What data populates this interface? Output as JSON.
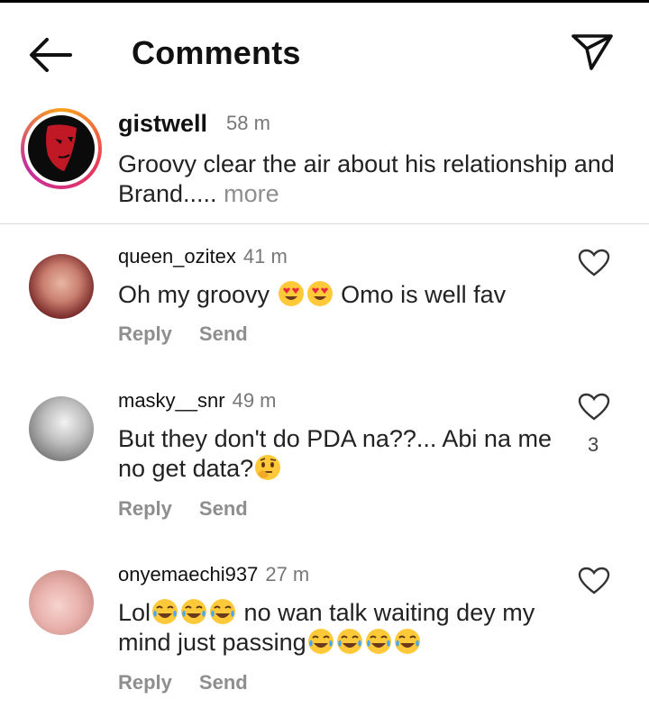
{
  "header": {
    "title": "Comments",
    "back_icon": "arrow-left-icon",
    "share_icon": "paper-plane-icon"
  },
  "caption": {
    "username": "gistwell",
    "time": "58 m",
    "text": "Groovy clear the air about his relationship and Brand.....",
    "more": "more"
  },
  "comments": [
    {
      "username": "queen_ozitex",
      "time": "41 m",
      "text_before": "Oh my groovy",
      "emojis_mid": [
        "heart-eyes",
        "heart-eyes"
      ],
      "text_after": "Omo is well fav",
      "reply": "Reply",
      "send": "Send"
    },
    {
      "username": "masky__snr",
      "time": "49 m",
      "text_line1": "But they don't do PDA na??... Abi na me",
      "text_line2": "no get data?",
      "emojis_end": [
        "thinking-face"
      ],
      "likes": "3",
      "reply": "Reply",
      "send": "Send"
    },
    {
      "username": "onyemaechi937",
      "time": "27 m",
      "text_start": "Lol",
      "emojis_a": [
        "tears-of-joy",
        "tears-of-joy",
        "tears-of-joy"
      ],
      "text_mid": "no wan talk waiting dey my",
      "text_line2": "mind just passing",
      "emojis_b": [
        "tears-of-joy",
        "tears-of-joy",
        "tears-of-joy",
        "tears-of-joy"
      ],
      "reply": "Reply",
      "send": "Send"
    }
  ],
  "colors": {
    "muted": "#8e8e8e",
    "emoji_yellow": "#ffc93a",
    "heart_eye_red": "#e8273e"
  }
}
